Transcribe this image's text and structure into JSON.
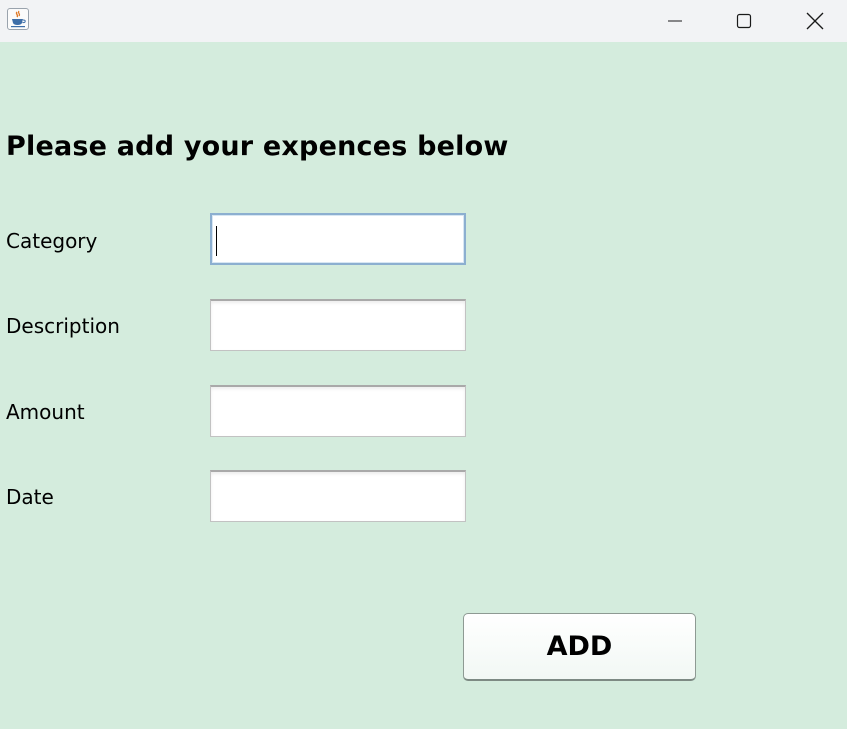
{
  "window": {
    "app_icon": "java-cup-icon",
    "controls": [
      "minimize-icon",
      "maximize-icon",
      "close-icon"
    ]
  },
  "form": {
    "heading": "Please add your expences below",
    "fields": [
      {
        "label": "Category",
        "value": ""
      },
      {
        "label": "Description",
        "value": ""
      },
      {
        "label": "Amount",
        "value": ""
      },
      {
        "label": "Date",
        "value": ""
      }
    ],
    "add_label": "ADD"
  },
  "colors": {
    "background": "#d4ecdd",
    "titlebar": "#f2f3f5",
    "focus_border": "#8cafd0"
  }
}
